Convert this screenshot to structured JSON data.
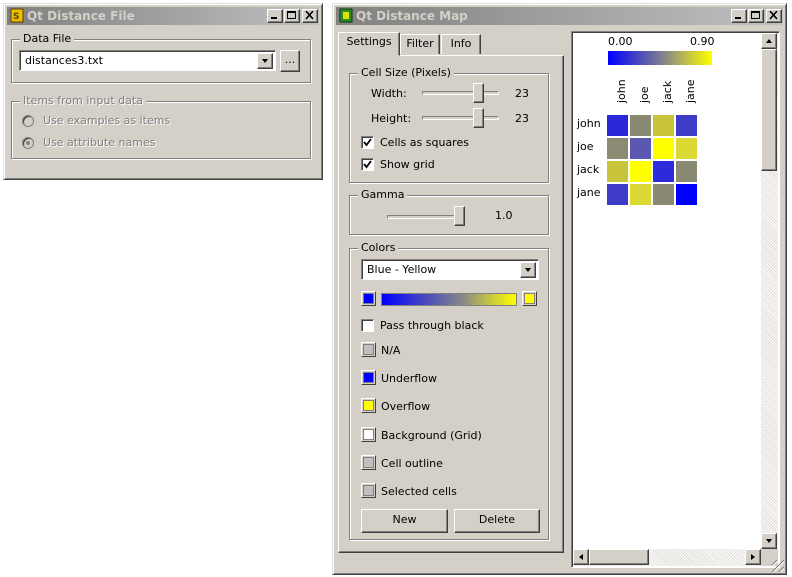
{
  "distance_file_window": {
    "title": "Qt Distance File",
    "data_file_group": "Data File",
    "data_file_value": "distances3.txt",
    "browse_label": "...",
    "items_group": "Items from input data",
    "radio_examples": "Use examples as items",
    "radio_attributes": "Use attribute names"
  },
  "distance_map_window": {
    "title": "Qt Distance Map",
    "tabs": [
      "Settings",
      "Filter",
      "Info"
    ],
    "cell_size": {
      "group": "Cell Size (Pixels)",
      "width_label": "Width:",
      "width_value": "23",
      "height_label": "Height:",
      "height_value": "23",
      "cells_as_squares": "Cells as squares",
      "show_grid": "Show grid"
    },
    "gamma": {
      "group": "Gamma",
      "value": "1.0"
    },
    "colors": {
      "group": "Colors",
      "palette": "Blue - Yellow",
      "low_color": "#0000ff",
      "high_color": "#ffff00",
      "pass_through_black": "Pass through black",
      "na": "N/A",
      "underflow": "Underflow",
      "overflow": "Overflow",
      "background": "Background (Grid)",
      "cell_outline": "Cell outline",
      "selected_cells": "Selected cells",
      "new_button": "New",
      "delete_button": "Delete"
    },
    "legend": {
      "min": "0.00",
      "max": "0.90"
    },
    "heatmap": {
      "labels": [
        "john",
        "joe",
        "jack",
        "jane"
      ],
      "cells": [
        [
          "#2b28da",
          "#898974",
          "#c9c53b",
          "#3d3bc7"
        ],
        [
          "#8b8a72",
          "#5a58b0",
          "#ffff00",
          "#dcd834"
        ],
        [
          "#c8c53c",
          "#ffff00",
          "#2d2bd9",
          "#8a8973"
        ],
        [
          "#3d3bc8",
          "#dcd834",
          "#8a8973",
          "#0000ff"
        ]
      ]
    }
  }
}
